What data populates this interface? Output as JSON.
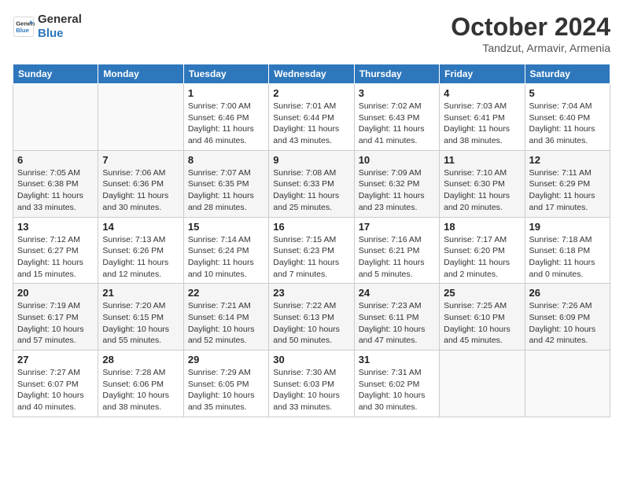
{
  "logo": {
    "line1": "General",
    "line2": "Blue"
  },
  "title": "October 2024",
  "subtitle": "Tandzut, Armavir, Armenia",
  "days_of_week": [
    "Sunday",
    "Monday",
    "Tuesday",
    "Wednesday",
    "Thursday",
    "Friday",
    "Saturday"
  ],
  "weeks": [
    [
      {
        "num": "",
        "info": ""
      },
      {
        "num": "",
        "info": ""
      },
      {
        "num": "1",
        "info": "Sunrise: 7:00 AM\nSunset: 6:46 PM\nDaylight: 11 hours\nand 46 minutes."
      },
      {
        "num": "2",
        "info": "Sunrise: 7:01 AM\nSunset: 6:44 PM\nDaylight: 11 hours\nand 43 minutes."
      },
      {
        "num": "3",
        "info": "Sunrise: 7:02 AM\nSunset: 6:43 PM\nDaylight: 11 hours\nand 41 minutes."
      },
      {
        "num": "4",
        "info": "Sunrise: 7:03 AM\nSunset: 6:41 PM\nDaylight: 11 hours\nand 38 minutes."
      },
      {
        "num": "5",
        "info": "Sunrise: 7:04 AM\nSunset: 6:40 PM\nDaylight: 11 hours\nand 36 minutes."
      }
    ],
    [
      {
        "num": "6",
        "info": "Sunrise: 7:05 AM\nSunset: 6:38 PM\nDaylight: 11 hours\nand 33 minutes."
      },
      {
        "num": "7",
        "info": "Sunrise: 7:06 AM\nSunset: 6:36 PM\nDaylight: 11 hours\nand 30 minutes."
      },
      {
        "num": "8",
        "info": "Sunrise: 7:07 AM\nSunset: 6:35 PM\nDaylight: 11 hours\nand 28 minutes."
      },
      {
        "num": "9",
        "info": "Sunrise: 7:08 AM\nSunset: 6:33 PM\nDaylight: 11 hours\nand 25 minutes."
      },
      {
        "num": "10",
        "info": "Sunrise: 7:09 AM\nSunset: 6:32 PM\nDaylight: 11 hours\nand 23 minutes."
      },
      {
        "num": "11",
        "info": "Sunrise: 7:10 AM\nSunset: 6:30 PM\nDaylight: 11 hours\nand 20 minutes."
      },
      {
        "num": "12",
        "info": "Sunrise: 7:11 AM\nSunset: 6:29 PM\nDaylight: 11 hours\nand 17 minutes."
      }
    ],
    [
      {
        "num": "13",
        "info": "Sunrise: 7:12 AM\nSunset: 6:27 PM\nDaylight: 11 hours\nand 15 minutes."
      },
      {
        "num": "14",
        "info": "Sunrise: 7:13 AM\nSunset: 6:26 PM\nDaylight: 11 hours\nand 12 minutes."
      },
      {
        "num": "15",
        "info": "Sunrise: 7:14 AM\nSunset: 6:24 PM\nDaylight: 11 hours\nand 10 minutes."
      },
      {
        "num": "16",
        "info": "Sunrise: 7:15 AM\nSunset: 6:23 PM\nDaylight: 11 hours\nand 7 minutes."
      },
      {
        "num": "17",
        "info": "Sunrise: 7:16 AM\nSunset: 6:21 PM\nDaylight: 11 hours\nand 5 minutes."
      },
      {
        "num": "18",
        "info": "Sunrise: 7:17 AM\nSunset: 6:20 PM\nDaylight: 11 hours\nand 2 minutes."
      },
      {
        "num": "19",
        "info": "Sunrise: 7:18 AM\nSunset: 6:18 PM\nDaylight: 11 hours\nand 0 minutes."
      }
    ],
    [
      {
        "num": "20",
        "info": "Sunrise: 7:19 AM\nSunset: 6:17 PM\nDaylight: 10 hours\nand 57 minutes."
      },
      {
        "num": "21",
        "info": "Sunrise: 7:20 AM\nSunset: 6:15 PM\nDaylight: 10 hours\nand 55 minutes."
      },
      {
        "num": "22",
        "info": "Sunrise: 7:21 AM\nSunset: 6:14 PM\nDaylight: 10 hours\nand 52 minutes."
      },
      {
        "num": "23",
        "info": "Sunrise: 7:22 AM\nSunset: 6:13 PM\nDaylight: 10 hours\nand 50 minutes."
      },
      {
        "num": "24",
        "info": "Sunrise: 7:23 AM\nSunset: 6:11 PM\nDaylight: 10 hours\nand 47 minutes."
      },
      {
        "num": "25",
        "info": "Sunrise: 7:25 AM\nSunset: 6:10 PM\nDaylight: 10 hours\nand 45 minutes."
      },
      {
        "num": "26",
        "info": "Sunrise: 7:26 AM\nSunset: 6:09 PM\nDaylight: 10 hours\nand 42 minutes."
      }
    ],
    [
      {
        "num": "27",
        "info": "Sunrise: 7:27 AM\nSunset: 6:07 PM\nDaylight: 10 hours\nand 40 minutes."
      },
      {
        "num": "28",
        "info": "Sunrise: 7:28 AM\nSunset: 6:06 PM\nDaylight: 10 hours\nand 38 minutes."
      },
      {
        "num": "29",
        "info": "Sunrise: 7:29 AM\nSunset: 6:05 PM\nDaylight: 10 hours\nand 35 minutes."
      },
      {
        "num": "30",
        "info": "Sunrise: 7:30 AM\nSunset: 6:03 PM\nDaylight: 10 hours\nand 33 minutes."
      },
      {
        "num": "31",
        "info": "Sunrise: 7:31 AM\nSunset: 6:02 PM\nDaylight: 10 hours\nand 30 minutes."
      },
      {
        "num": "",
        "info": ""
      },
      {
        "num": "",
        "info": ""
      }
    ]
  ]
}
